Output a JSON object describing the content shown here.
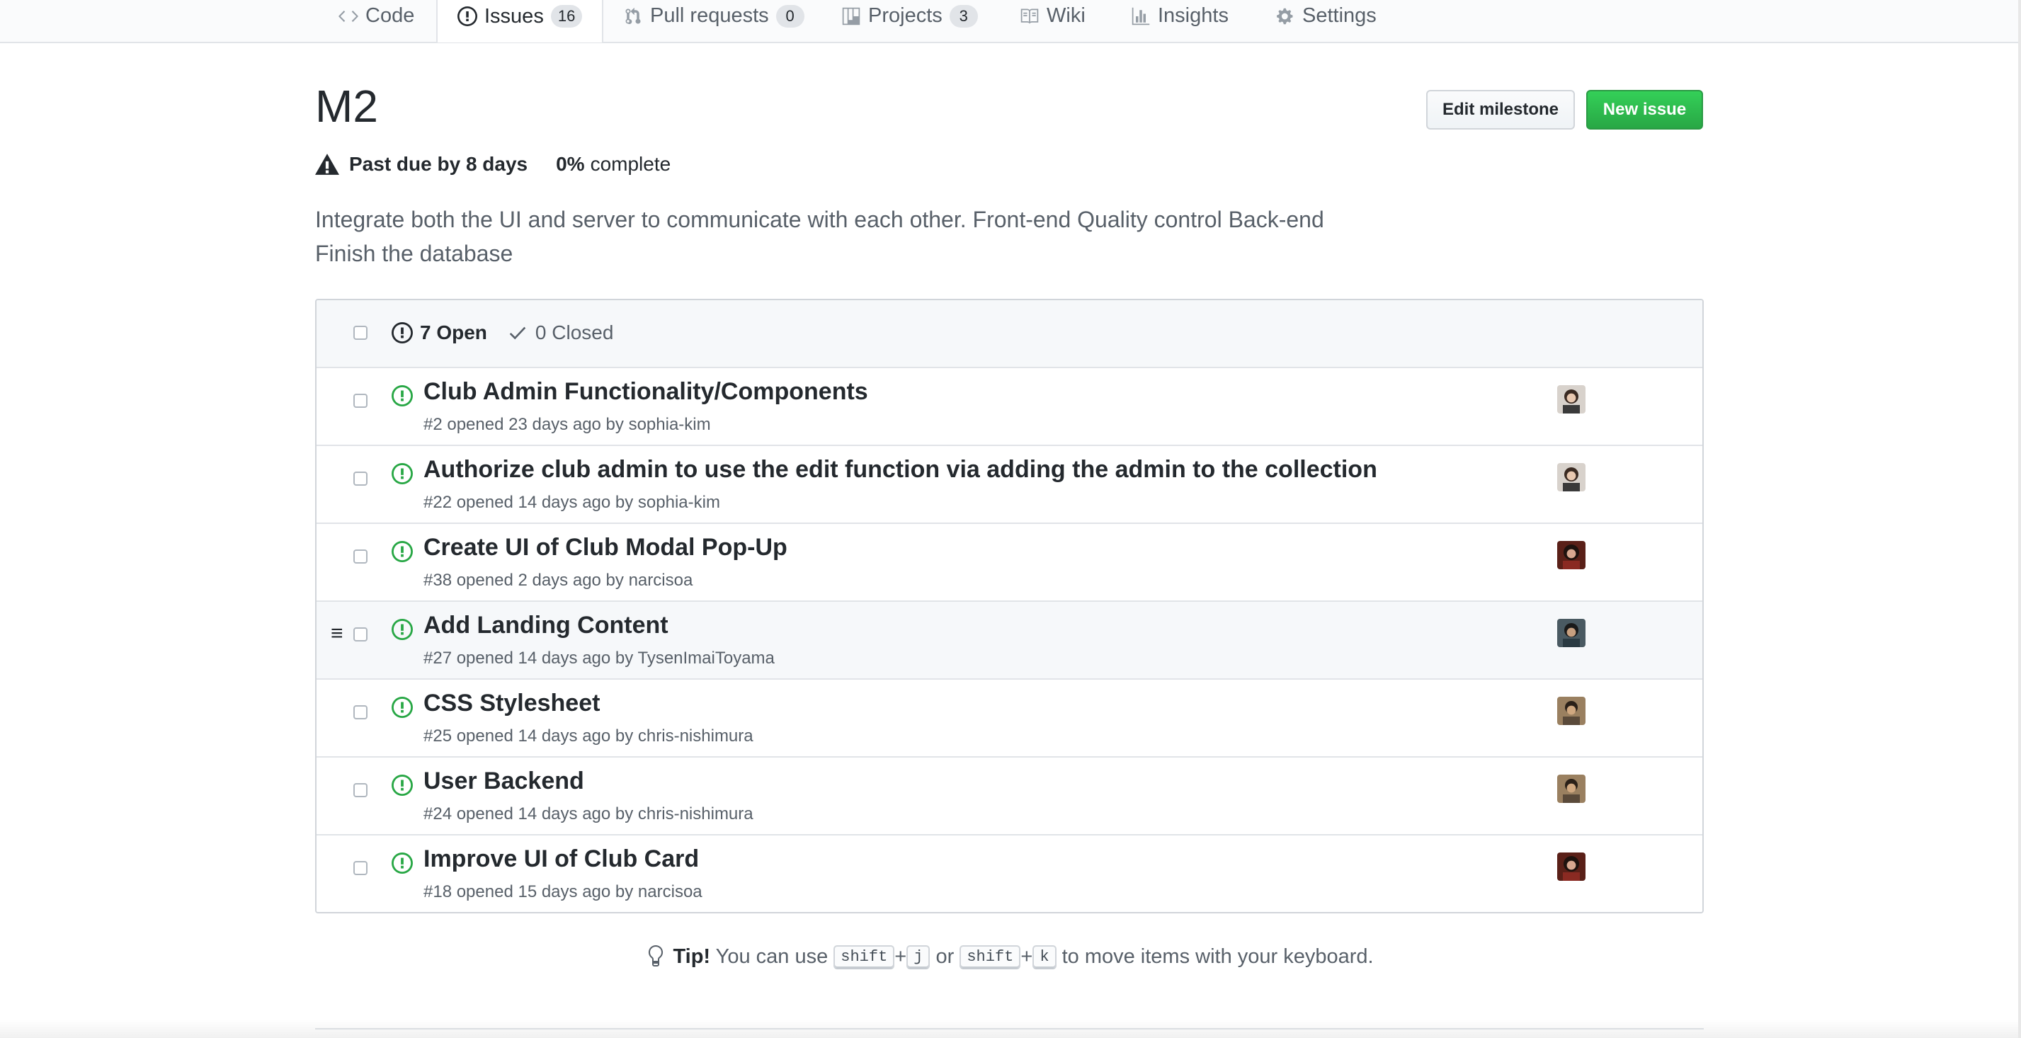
{
  "nav": {
    "tabs": [
      {
        "label": "Code",
        "icon": "code-icon"
      },
      {
        "label": "Issues",
        "icon": "issue-opened-icon",
        "count": "16",
        "selected": true
      },
      {
        "label": "Pull requests",
        "icon": "pull-request-icon",
        "count": "0"
      },
      {
        "label": "Projects",
        "icon": "project-icon",
        "count": "3"
      },
      {
        "label": "Wiki",
        "icon": "book-icon"
      },
      {
        "label": "Insights",
        "icon": "graph-icon"
      },
      {
        "label": "Settings",
        "icon": "gear-icon"
      }
    ]
  },
  "milestone": {
    "title": "M2",
    "due_text": "Past due by 8 days",
    "percent": "0%",
    "percent_suffix": "complete",
    "description": "Integrate both the UI and server to communicate with each other. Front-end Quality control Back-end Finish the database"
  },
  "buttons": {
    "edit": "Edit milestone",
    "new": "New issue"
  },
  "states": {
    "open": "7 Open",
    "closed": "0 Closed"
  },
  "issues": [
    {
      "title": "Club Admin Functionality/Components",
      "meta": "#2 opened 23 days ago by sophia-kim",
      "avatar_color": "#6b4a3a"
    },
    {
      "title": "Authorize club admin to use the edit function via adding the admin to the collection",
      "meta": "#22 opened 14 days ago by sophia-kim",
      "avatar_color": "#6b4a3a"
    },
    {
      "title": "Create UI of Club Modal Pop-Up",
      "meta": "#38 opened 2 days ago by narcisoa",
      "avatar_color": "#7a2a22"
    },
    {
      "title": "Add Landing Content",
      "meta": "#27 opened 14 days ago by TysenImaiToyama",
      "avatar_color": "#3d4a52"
    },
    {
      "title": "CSS Stylesheet",
      "meta": "#25 opened 14 days ago by chris-nishimura",
      "avatar_color": "#8a6a4a"
    },
    {
      "title": "User Backend",
      "meta": "#24 opened 14 days ago by chris-nishimura",
      "avatar_color": "#8a6a4a"
    },
    {
      "title": "Improve UI of Club Card",
      "meta": "#18 opened 15 days ago by narcisoa",
      "avatar_color": "#7a2a22"
    }
  ],
  "tip": {
    "label": "Tip!",
    "text1": "You can use",
    "key1": "shift",
    "key2": "j",
    "or": "or",
    "key3": "shift",
    "key4": "k",
    "text2": "to move items with your keyboard.",
    "plus": "+"
  },
  "colors": {
    "open_green": "#28a745",
    "new_issue_button": "#2ea44f"
  }
}
